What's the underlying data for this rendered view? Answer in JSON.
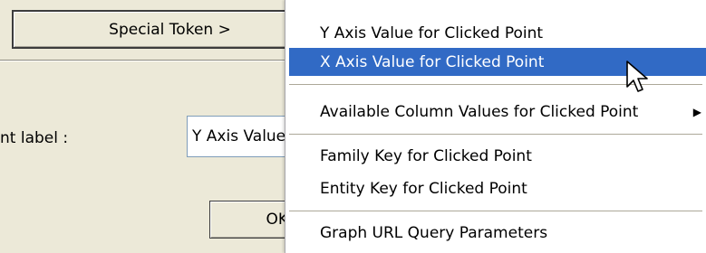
{
  "dialog": {
    "special_token_button": "Special Token >",
    "point_label_text": "nt label :",
    "point_label_value": "Y Axis Value",
    "ok_button": "OK"
  },
  "menu": {
    "items": [
      {
        "label": "Y Axis Value for Clicked Point",
        "highlighted": false,
        "has_submenu": false
      },
      {
        "label": "X Axis Value for Clicked Point",
        "highlighted": true,
        "has_submenu": false
      },
      {
        "label": "Available Column Values for Clicked Point",
        "highlighted": false,
        "has_submenu": true
      },
      {
        "label": "Family Key for Clicked Point",
        "highlighted": false,
        "has_submenu": false
      },
      {
        "label": "Entity Key for Clicked Point",
        "highlighted": false,
        "has_submenu": false
      },
      {
        "label": "Graph URL Query Parameters",
        "highlighted": false,
        "has_submenu": false
      }
    ],
    "submenu_arrow_icon": "triangle-right-icon",
    "highlight_color": "#316ac5"
  },
  "cursor_icon": "arrow-cursor-icon"
}
